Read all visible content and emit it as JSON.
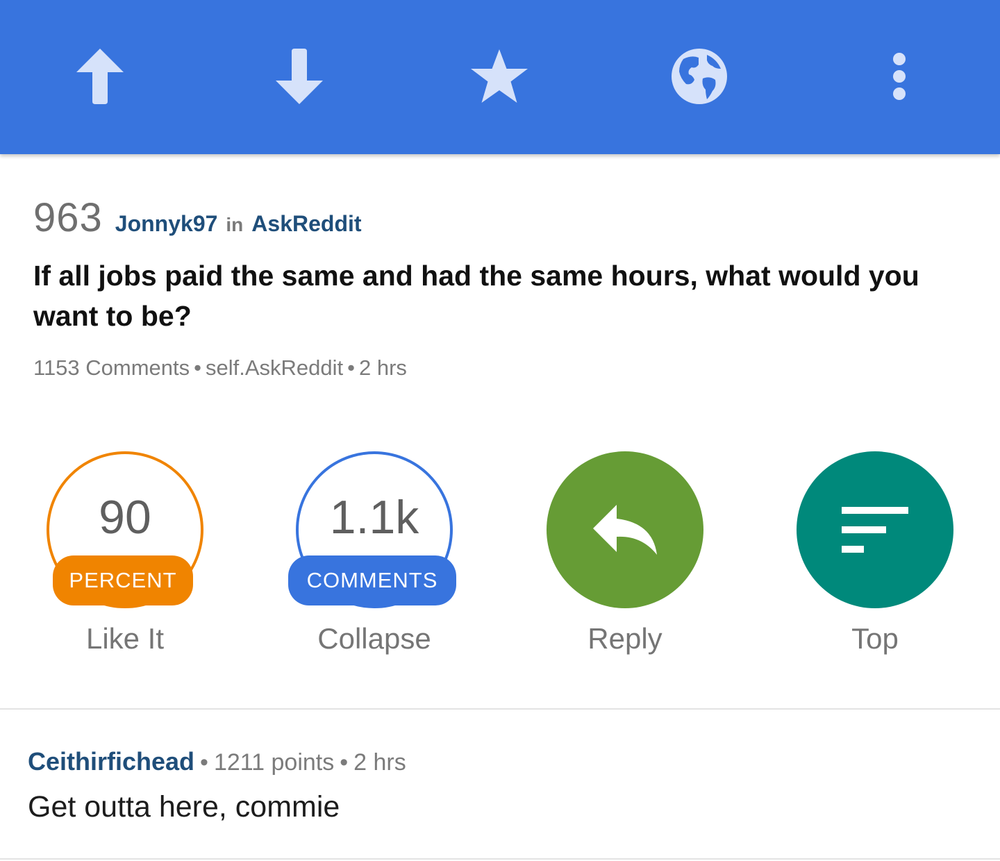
{
  "toolbar": {
    "buttons": [
      {
        "icon": "upvote-arrow-icon"
      },
      {
        "icon": "downvote-arrow-icon"
      },
      {
        "icon": "star-icon"
      },
      {
        "icon": "globe-icon"
      },
      {
        "icon": "more-vertical-icon"
      }
    ],
    "colors": {
      "background": "#3874de",
      "icon": "#d6e2fa"
    }
  },
  "post": {
    "score": "963",
    "author": "Jonnyk97",
    "in_word": "in",
    "subreddit": "AskReddit",
    "title": "If all jobs paid the same and had the same hours, what would you want to be?",
    "comments": "1153 Comments",
    "domain": "self.AskReddit",
    "age": "2 hrs",
    "separator": "•"
  },
  "actions": {
    "like": {
      "value": "90",
      "badge": "PERCENT",
      "label": "Like It",
      "color": "#f08400"
    },
    "collapse": {
      "value": "1.1k",
      "badge": "COMMENTS",
      "label": "Collapse",
      "color": "#3874de"
    },
    "reply": {
      "icon": "reply-icon",
      "label": "Reply",
      "color": "#669c35"
    },
    "top": {
      "icon": "sort-icon",
      "label": "Top",
      "color": "#00897b"
    }
  },
  "comment": {
    "author": "Ceithirfichead",
    "points": "1211 points",
    "age": "2 hrs",
    "separator": "•",
    "body": "Get outta here, commie"
  }
}
